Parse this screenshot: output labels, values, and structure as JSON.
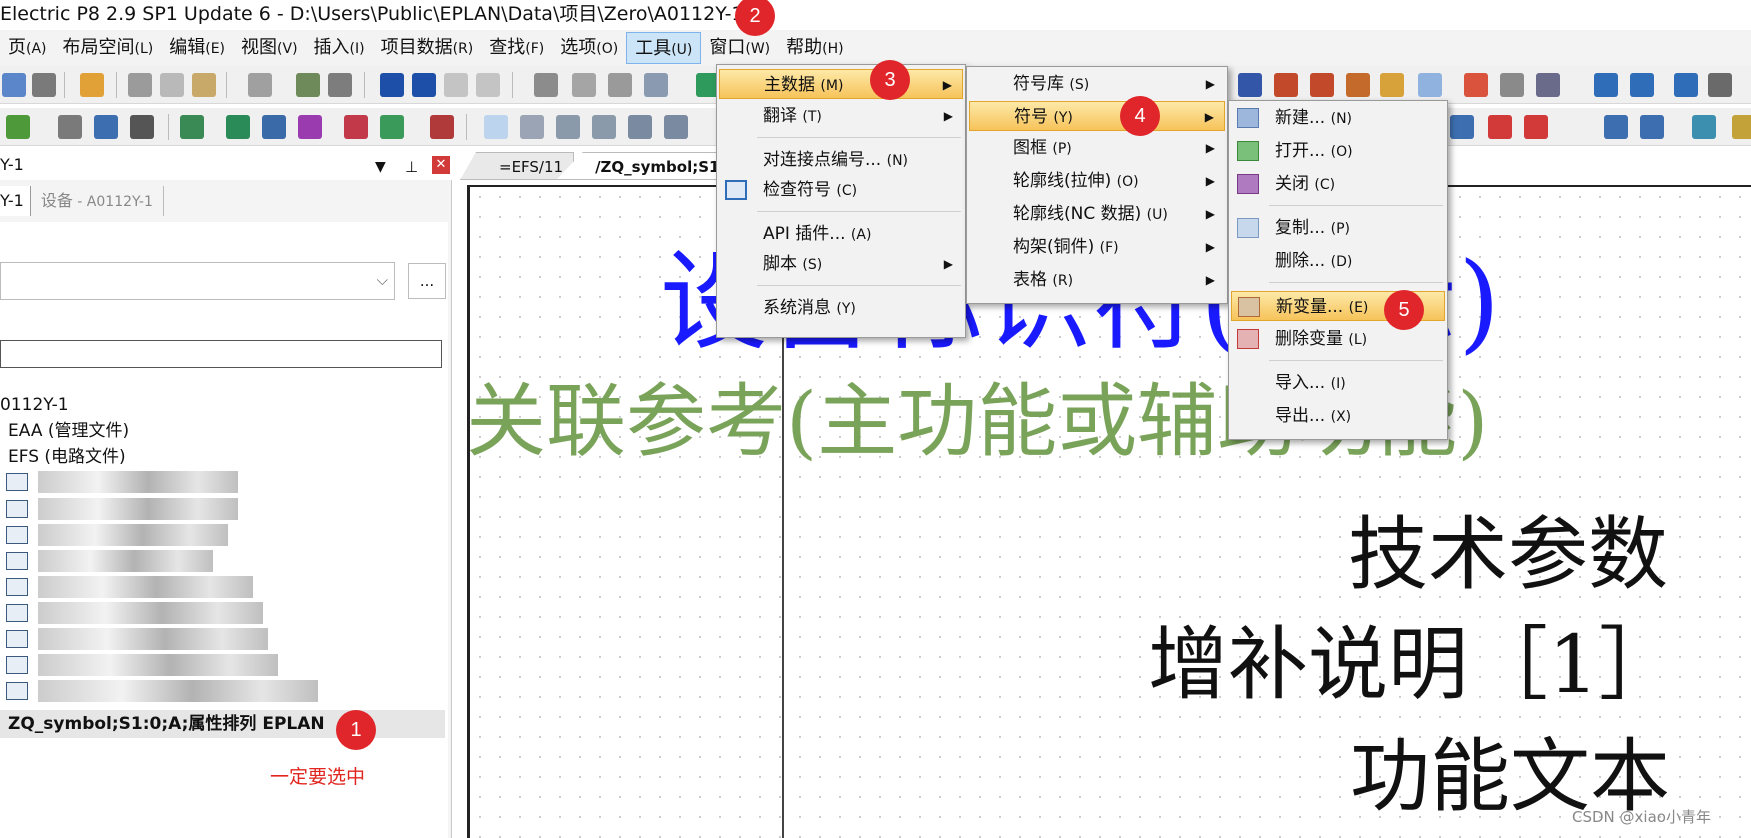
{
  "title": "Electric P8 2.9 SP1 Update 6 - D:\\Users\\Public\\EPLAN\\Data\\项目\\Zero\\A0112Y-1",
  "menubar": [
    {
      "label": "页",
      "key": "(A)"
    },
    {
      "label": "布局空间",
      "key": "(L)"
    },
    {
      "label": "编辑",
      "key": "(E)"
    },
    {
      "label": "视图",
      "key": "(V)"
    },
    {
      "label": "插入",
      "key": "(I)"
    },
    {
      "label": "项目数据",
      "key": "(R)"
    },
    {
      "label": "查找",
      "key": "(F)"
    },
    {
      "label": "选项",
      "key": "(O)"
    },
    {
      "label": "工具",
      "key": "(U)"
    },
    {
      "label": "窗口",
      "key": "(W)"
    },
    {
      "label": "帮助",
      "key": "(H)"
    }
  ],
  "panel": {
    "header": "Y-1",
    "tab_active": "Y-1",
    "tab_other": "设备",
    "tab_other_suffix": " - A0112Y-1",
    "dots": "...",
    "tree": {
      "root": "0112Y-1",
      "eaa": "EAA (管理文件)",
      "efs": "EFS (电路文件)",
      "selected": "ZQ_symbol;S1:0;A;属性排列 EPLAN"
    },
    "note": "一定要选中"
  },
  "doc_tabs": [
    "=EFS/11",
    "/ZQ_symbol;S1:0"
  ],
  "canvas_text": {
    "line1": "设备标识符(显示)",
    "line2": "关联参考(主功能或辅助功能)",
    "line3": "技术参数",
    "line4": "增补说明［1］",
    "line5": "功能文本"
  },
  "menu_tools": [
    {
      "label": "主数据",
      "key": "(M)",
      "sub": true
    },
    {
      "label": "翻译",
      "key": "(T)",
      "sub": true
    },
    {
      "label": "对连接点编号...",
      "key": "(N)"
    },
    {
      "label": "检查符号",
      "key": "(C)"
    },
    {
      "label": "API 插件...",
      "key": "(A)"
    },
    {
      "label": "脚本",
      "key": "(S)",
      "sub": true
    },
    {
      "label": "系统消息",
      "key": "(Y)"
    }
  ],
  "menu_master": [
    {
      "label": "符号库",
      "key": "(S)"
    },
    {
      "label": "符号",
      "key": "(Y)"
    },
    {
      "label": "图框",
      "key": "(P)"
    },
    {
      "label": "轮廓线(拉伸)",
      "key": "(O)"
    },
    {
      "label": "轮廓线(NC 数据)",
      "key": "(U)"
    },
    {
      "label": "构架(铜件)",
      "key": "(F)"
    },
    {
      "label": "表格",
      "key": "(R)"
    }
  ],
  "menu_symbol": [
    {
      "label": "新建...",
      "key": "(N)"
    },
    {
      "label": "打开...",
      "key": "(O)"
    },
    {
      "label": "关闭",
      "key": "(C)"
    },
    {
      "label": "复制...",
      "key": "(P)"
    },
    {
      "label": "删除...",
      "key": "(D)"
    },
    {
      "label": "新变量...",
      "key": "(E)"
    },
    {
      "label": "删除变量",
      "key": "(L)"
    },
    {
      "label": "导入...",
      "key": "(I)"
    },
    {
      "label": "导出...",
      "key": "(X)"
    }
  ],
  "badges": [
    "1",
    "2",
    "3",
    "4",
    "5"
  ],
  "watermark": "CSDN @xiao小青年",
  "colors": {
    "badge": "#e0262a",
    "canvas_blue": "#1a1aff",
    "canvas_green": "#7aa35a",
    "highlight": "#f6c35a"
  }
}
